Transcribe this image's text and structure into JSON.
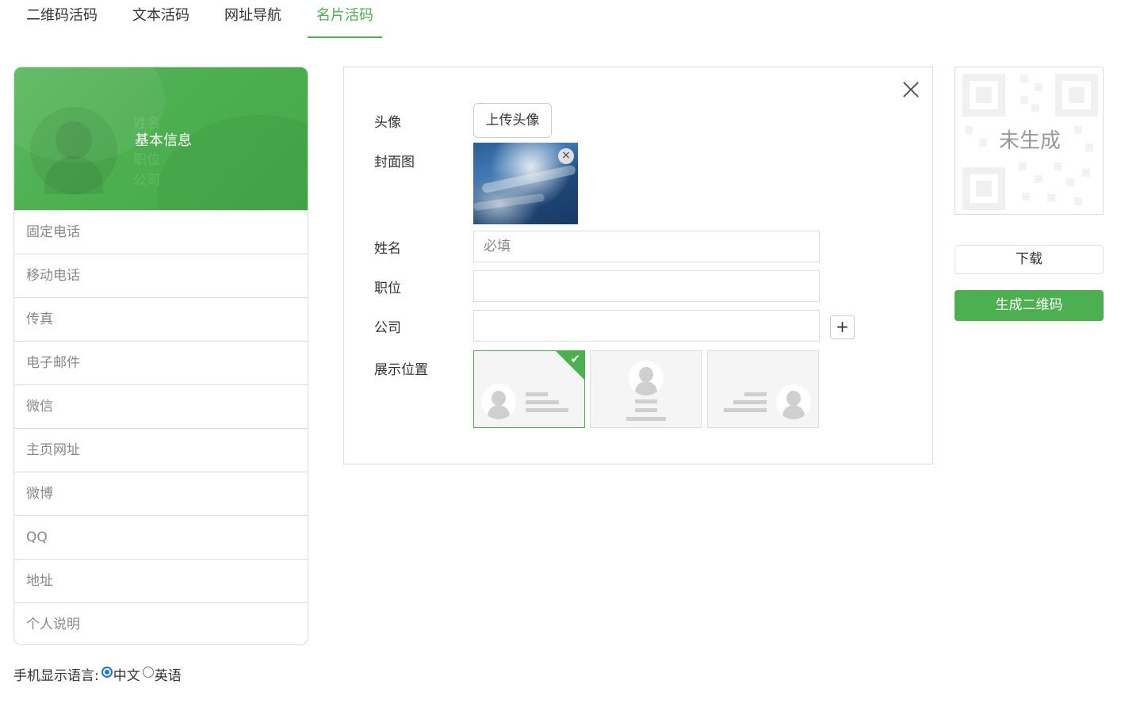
{
  "tabs": [
    {
      "label": "二维码活码",
      "active": false
    },
    {
      "label": "文本活码",
      "active": false
    },
    {
      "label": "网址导航",
      "active": false
    },
    {
      "label": "名片活码",
      "active": true
    }
  ],
  "card": {
    "ghost_labels": {
      "name": "姓名",
      "position": "职位",
      "company": "公司"
    },
    "header_title": "基本信息",
    "fields": [
      "固定电话",
      "移动电话",
      "传真",
      "电子邮件",
      "微信",
      "主页网址",
      "微博",
      "QQ",
      "地址",
      "个人说明"
    ]
  },
  "language": {
    "label": "手机显示语言:",
    "options": [
      {
        "label": "中文",
        "checked": true
      },
      {
        "label": "英语",
        "checked": false
      }
    ]
  },
  "form": {
    "avatar_label": "头像",
    "upload_button": "上传头像",
    "cover_label": "封面图",
    "remove_icon": "×",
    "name_label": "姓名",
    "name_placeholder": "必填",
    "position_label": "职位",
    "company_label": "公司",
    "add_symbol": "+",
    "display_label": "展示位置",
    "layout_options": [
      {
        "align": "left",
        "selected": true
      },
      {
        "align": "center",
        "selected": false
      },
      {
        "align": "right",
        "selected": false
      }
    ],
    "check_symbol": "✔"
  },
  "qr": {
    "status_text": "未生成",
    "download_button": "下载",
    "generate_button": "生成二维码"
  },
  "colors": {
    "accent": "#4caf50",
    "border": "#dcdcdc",
    "muted_text": "#888888"
  }
}
